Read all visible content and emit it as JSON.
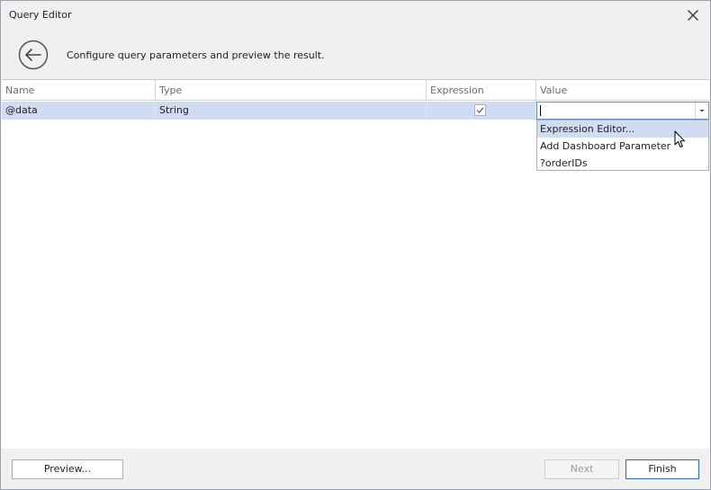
{
  "window": {
    "title": "Query Editor",
    "subtitle": "Configure query parameters and preview the result."
  },
  "icons": {
    "close": "close-icon",
    "back": "arrow-left-icon",
    "dropdown": "chevron-down-icon",
    "cursor": "mouse-pointer-icon"
  },
  "grid": {
    "columns": [
      "Name",
      "Type",
      "Expression",
      "Value"
    ],
    "rows": [
      {
        "name": "@data",
        "type": "String",
        "expression": true,
        "value": ""
      }
    ]
  },
  "dropdown": {
    "items": [
      "Expression Editor...",
      "Add Dashboard Parameter",
      "?orderIDs"
    ],
    "highlighted_index": 0
  },
  "footer": {
    "preview_label": "Preview...",
    "next_label": "Next",
    "finish_label": "Finish"
  },
  "colors": {
    "selection": "#cfdcf2",
    "primary_border": "#2f6bb3"
  }
}
